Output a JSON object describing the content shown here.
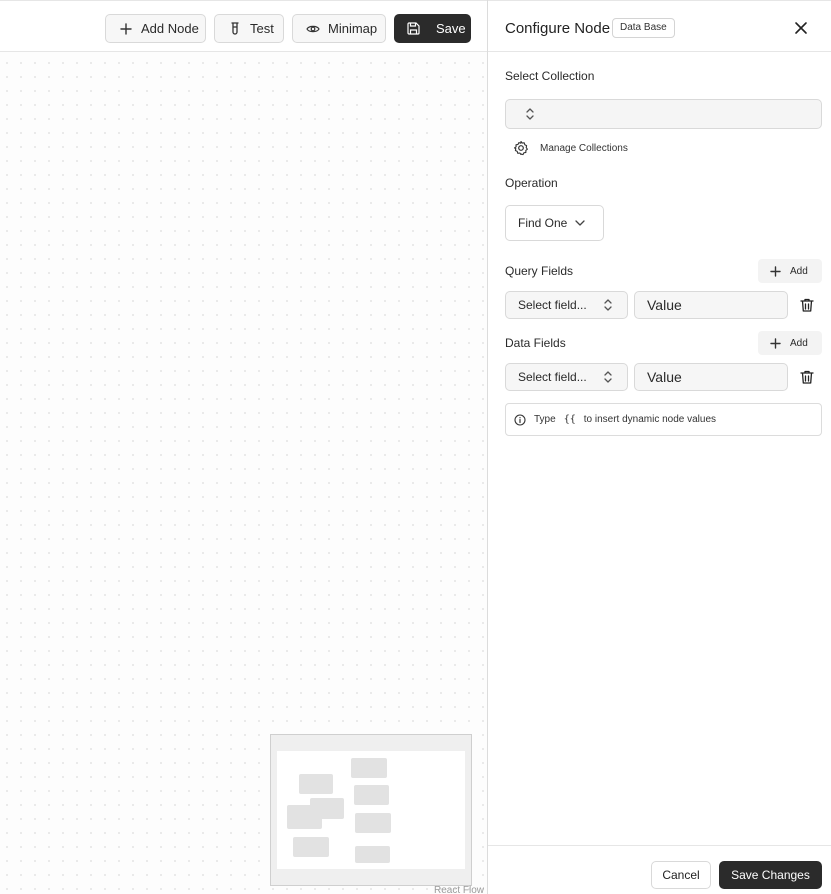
{
  "toolbar": {
    "add_node": "Add Node",
    "test": "Test",
    "minimap": "Minimap",
    "save": "Save"
  },
  "canvas": {
    "attribution": "React Flow"
  },
  "panel": {
    "title": "Configure Node",
    "badge": "Data Base",
    "select_collection_label": "Select Collection",
    "select_collection_value": "",
    "manage_collections": "Manage Collections",
    "operation_label": "Operation",
    "operation_value": "Find One",
    "query_fields": {
      "label": "Query Fields",
      "add": "Add",
      "field_placeholder": "Select field...",
      "value": "Value"
    },
    "data_fields": {
      "label": "Data Fields",
      "add": "Add",
      "field_placeholder": "Select field...",
      "value": "Value"
    },
    "hint": {
      "prefix": "Type",
      "code": "{{",
      "suffix": "to insert dynamic node values"
    },
    "footer": {
      "cancel": "Cancel",
      "save_changes": "Save Changes"
    }
  },
  "colors": {
    "primary_dark": "#2b2b2b",
    "border": "#d9d9d9",
    "muted_bg": "#f6f6f6"
  }
}
